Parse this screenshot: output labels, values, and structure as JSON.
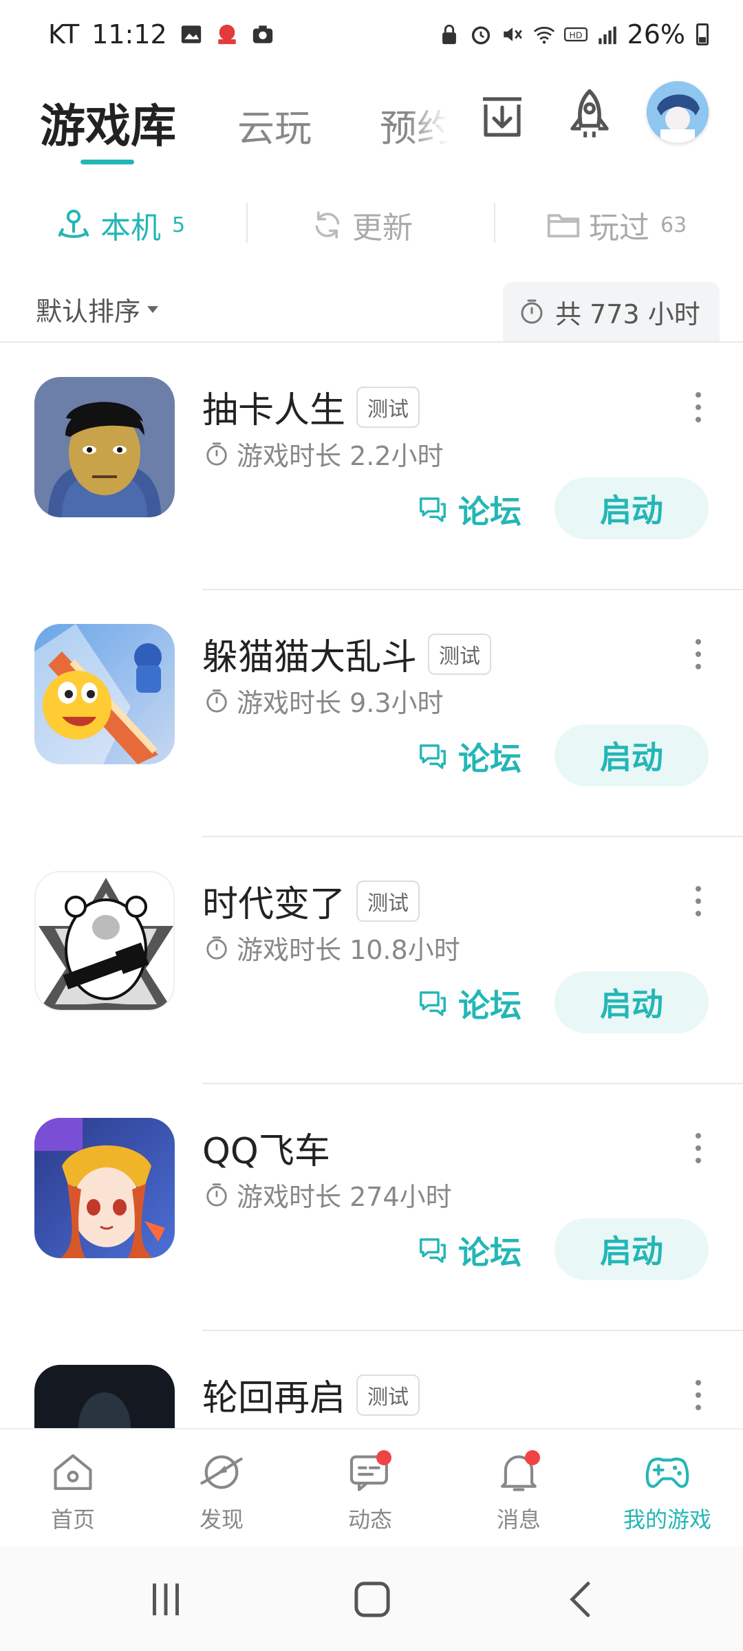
{
  "status_bar": {
    "carrier": "KT",
    "time": "11:12",
    "left_icons": [
      "gallery-icon",
      "app-notification-icon",
      "camera-icon"
    ],
    "right_icons": [
      "lock-icon",
      "alarm-icon",
      "mute-icon",
      "wifi-icon",
      "hd-icon",
      "signal-icon"
    ],
    "battery": "26%"
  },
  "top_tabs": {
    "active": "游戏库",
    "cloud": "云玩",
    "preorder": "预约"
  },
  "sub_tabs": [
    {
      "label": "本机",
      "count": "5",
      "icon": "device-icon"
    },
    {
      "label": "更新",
      "count": "",
      "icon": "refresh-icon"
    },
    {
      "label": "玩过",
      "count": "63",
      "icon": "folder-icon"
    }
  ],
  "sort": {
    "label": "默认排序"
  },
  "total_time": {
    "label": "共 773 小时"
  },
  "games": [
    {
      "name": "抽卡人生",
      "tag": "测试",
      "duration": "游戏时长 2.2小时",
      "forum": "论坛",
      "launch": "启动"
    },
    {
      "name": "躲猫猫大乱斗",
      "tag": "测试",
      "duration": "游戏时长 9.3小时",
      "forum": "论坛",
      "launch": "启动"
    },
    {
      "name": "时代变了",
      "tag": "测试",
      "duration": "游戏时长 10.8小时",
      "forum": "论坛",
      "launch": "启动"
    },
    {
      "name": "QQ飞车",
      "tag": "",
      "duration": "游戏时长 274小时",
      "forum": "论坛",
      "launch": "启动"
    },
    {
      "name": "轮回再启",
      "tag": "测试",
      "duration": "",
      "forum": "",
      "launch": ""
    }
  ],
  "bottom_nav": [
    {
      "label": "首页",
      "icon": "home-icon"
    },
    {
      "label": "发现",
      "icon": "discover-icon"
    },
    {
      "label": "动态",
      "icon": "feed-icon",
      "badge": true
    },
    {
      "label": "消息",
      "icon": "bell-icon",
      "badge": true
    },
    {
      "label": "我的游戏",
      "icon": "gamepad-icon",
      "active": true
    }
  ],
  "colors": {
    "accent": "#24b6b6",
    "badge": "#f04444"
  }
}
